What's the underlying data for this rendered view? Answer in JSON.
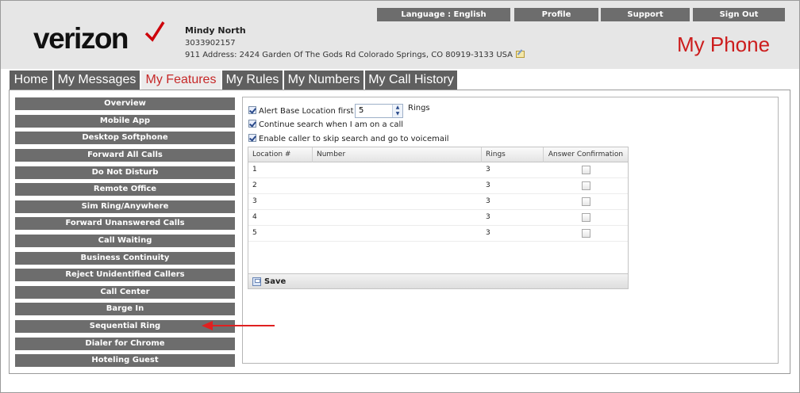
{
  "brand": {
    "logo_text": "verizon",
    "accent_color": "#cd040b"
  },
  "user": {
    "name": "Mindy North",
    "phone": "3033902157",
    "address": "911 Address: 2424 Garden Of The Gods Rd Colorado Springs, CO 80919-3133 USA"
  },
  "top_nav": {
    "language": "Language : English",
    "profile": "Profile",
    "support": "Support",
    "sign_out": "Sign Out"
  },
  "app_title": "My Phone",
  "tabs": [
    {
      "label": "Home",
      "active": false
    },
    {
      "label": "My Messages",
      "active": false
    },
    {
      "label": "My Features",
      "active": true
    },
    {
      "label": "My Rules",
      "active": false
    },
    {
      "label": "My Numbers",
      "active": false
    },
    {
      "label": "My Call History",
      "active": false
    }
  ],
  "sidebar": {
    "items": [
      {
        "label": "Overview"
      },
      {
        "label": "Mobile App"
      },
      {
        "label": "Desktop Softphone"
      },
      {
        "label": "Forward All Calls"
      },
      {
        "label": "Do Not Disturb"
      },
      {
        "label": "Remote Office"
      },
      {
        "label": "Sim Ring/Anywhere"
      },
      {
        "label": "Forward Unanswered Calls"
      },
      {
        "label": "Call Waiting"
      },
      {
        "label": "Business Continuity"
      },
      {
        "label": "Reject Unidentified Callers"
      },
      {
        "label": "Call Center"
      },
      {
        "label": "Barge In"
      },
      {
        "label": "Sequential Ring"
      },
      {
        "label": "Dialer for Chrome"
      },
      {
        "label": "Hoteling Guest"
      }
    ]
  },
  "settings": {
    "alert_base": {
      "label": "Alert Base Location first for",
      "checked": true,
      "value": "5",
      "suffix": "Rings"
    },
    "continue_search": {
      "label": "Continue search when I am on a call",
      "checked": true
    },
    "skip_search": {
      "label": "Enable caller to skip search and go to voicemail",
      "checked": true
    }
  },
  "locations_table": {
    "columns": [
      "Location #",
      "Number",
      "Rings",
      "Answer Confirmation"
    ],
    "rows": [
      {
        "location": "1",
        "number": "",
        "rings": "3",
        "confirm": false
      },
      {
        "location": "2",
        "number": "",
        "rings": "3",
        "confirm": false
      },
      {
        "location": "3",
        "number": "",
        "rings": "3",
        "confirm": false
      },
      {
        "location": "4",
        "number": "",
        "rings": "3",
        "confirm": false
      },
      {
        "location": "5",
        "number": "",
        "rings": "3",
        "confirm": false
      }
    ]
  },
  "save_label": "Save",
  "annotation": {
    "arrow_color": "#e02020"
  }
}
